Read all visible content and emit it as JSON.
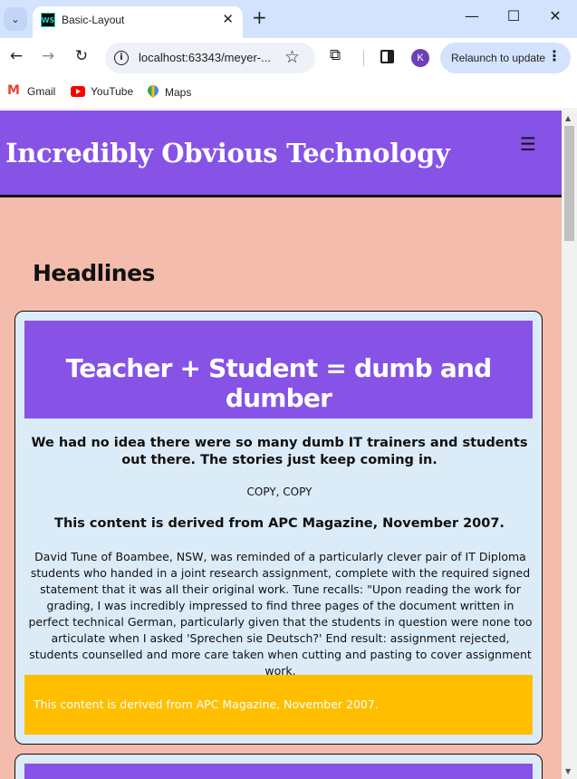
{
  "browser": {
    "tab_title": "Basic-Layout",
    "tab_favicon_text": "WS",
    "url": "localhost:63343/meyer-...",
    "relaunch_label": "Relaunch to update",
    "avatar_initial": "K",
    "bookmarks": [
      {
        "label": "Gmail",
        "icon": "gmail-icon"
      },
      {
        "label": "YouTube",
        "icon": "youtube-icon"
      },
      {
        "label": "Maps",
        "icon": "maps-icon"
      }
    ]
  },
  "site": {
    "title": "Incredibly Obvious Technology",
    "menu_icon": "hamburger-icon",
    "section_heading": "Headlines"
  },
  "article": {
    "title": "Teacher + Student = dumb and dumber",
    "subtitle": "We had no idea there were so many dumb IT trainers and students out there. The stories just keep coming in.",
    "label": "COPY, COPY",
    "source": "This content is derived from APC Magazine, November 2007.",
    "body": "David Tune of Boambee, NSW, was reminded of a particularly clever pair of IT Diploma students who handed in a joint research assignment, complete with the required signed statement that it was all their original work. Tune recalls: \"Upon reading the work for grading, I was incredibly impressed to find three pages of the document written in perfect technical German, particularly given that the students in question were none too articulate when I asked 'Sprechen sie Deutsch?' End result: assignment rejected, students counselled and more care taken when cutting and pasting to cover assignment work.",
    "footer": "This content is derived from APC Magazine, November 2007."
  },
  "colors": {
    "header_bg": "#8653e6",
    "page_bg": "#f4bcac",
    "card_bg": "#dcebf8",
    "footer_bg": "#ffbf00"
  }
}
